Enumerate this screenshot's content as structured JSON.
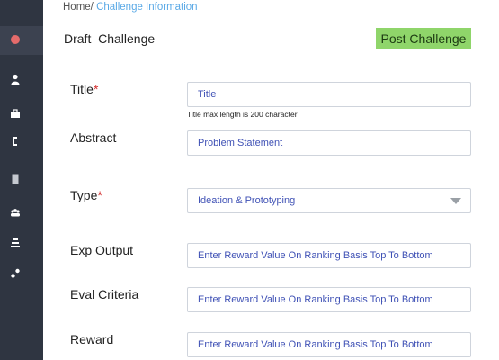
{
  "breadcrumb": {
    "home": "Home/",
    "current": " Challenge Information"
  },
  "page": {
    "title": "Draft  Challenge",
    "post_button": "Post Challenge"
  },
  "sidebar": {
    "icons": [
      "record-icon",
      "user-icon",
      "briefcase-icon",
      "bracket-icon",
      "document-icon",
      "group-icon",
      "stack-icon",
      "share-icon"
    ]
  },
  "form": {
    "title": {
      "label": "Title",
      "required": "*",
      "placeholder": "Title",
      "helper": "Title max length is 200 character"
    },
    "abstract": {
      "label": "Abstract",
      "placeholder": "Problem Statement"
    },
    "type": {
      "label": "Type",
      "required": "*",
      "value": "Ideation & Prototyping"
    },
    "exp_output": {
      "label": "Exp Output",
      "placeholder": "Enter Reward Value On Ranking Basis Top To Bottom"
    },
    "eval_criteria": {
      "label": "Eval Criteria",
      "placeholder": "Enter Reward Value On Ranking Basis Top To Bottom"
    },
    "reward": {
      "label": "Reward",
      "placeholder": "Enter Reward Value On Ranking Basis Top To Bottom"
    }
  },
  "colors": {
    "sidebar": "#2f3541",
    "accent_button": "#8fd56a",
    "required": "#d32f2f",
    "field_text": "#3f51b5",
    "breadcrumb_link": "#5aa9e6"
  }
}
